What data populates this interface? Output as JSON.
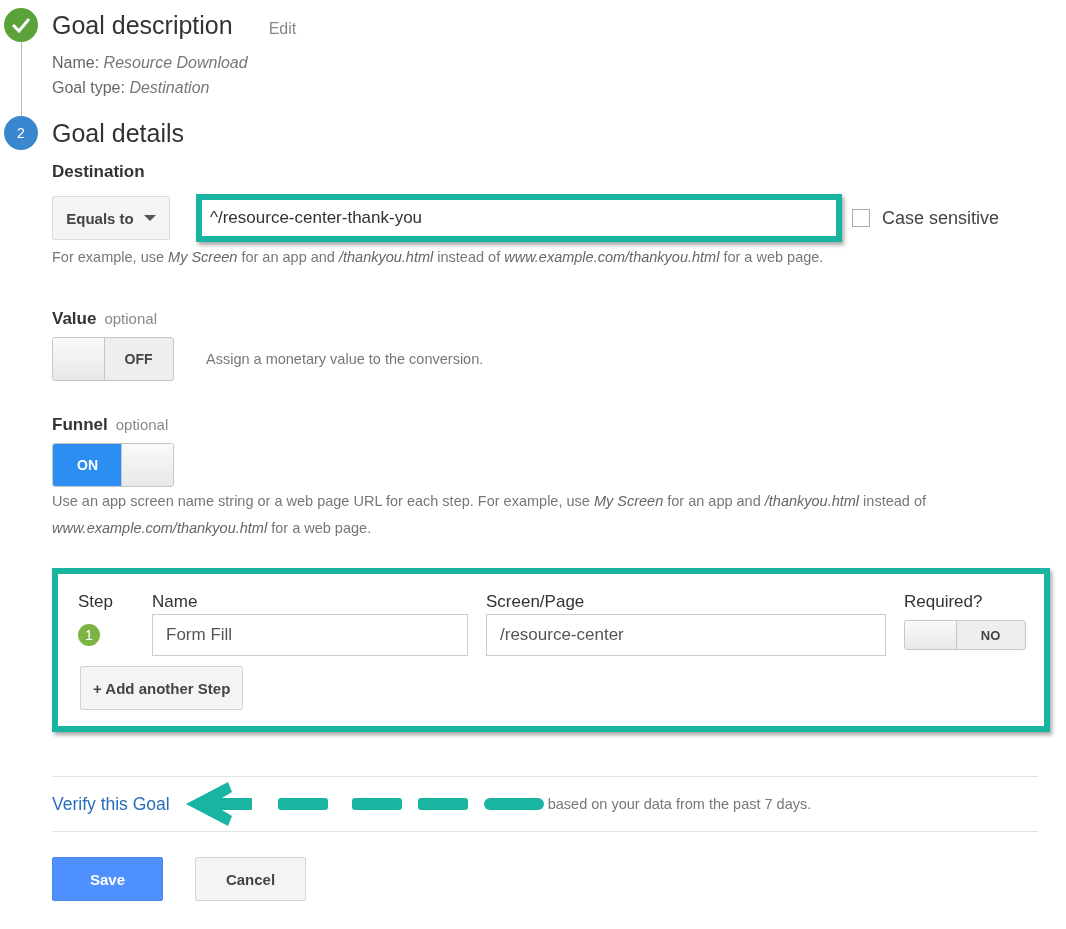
{
  "steps": [
    {
      "done": true,
      "title": "Goal description",
      "action": "Edit",
      "details": [
        {
          "label": "Name:",
          "value": "Resource Download"
        },
        {
          "label": "Goal type:",
          "value": "Destination"
        }
      ]
    },
    {
      "done": false,
      "number": "2",
      "title": "Goal details"
    }
  ],
  "destination": {
    "label": "Destination",
    "match": "Equals to",
    "value": "^/resource-center-thank-you",
    "highlighted": true,
    "case_sensitive": {
      "label": "Case sensitive",
      "checked": false
    },
    "hint": "For example, use *My Screen* for an app and */thankyou.html* instead of *www.example.com/thankyou.html* for a web page."
  },
  "value": {
    "label": "Value",
    "optional": "optional",
    "toggle": {
      "on": false,
      "text": "OFF"
    },
    "description": "Assign a monetary value to the conversion."
  },
  "funnel": {
    "label": "Funnel",
    "optional": "optional",
    "toggle": {
      "on": true,
      "text": "ON"
    },
    "hint": "Use an app screen name string or a web page URL for each step. For example, use *My Screen* for an app and */thankyou.html* instead of *www.example.com/thankyou.html* for a web page.",
    "highlighted": true,
    "columns": [
      "Step",
      "Name",
      "Screen/Page",
      "Required?"
    ],
    "rows": [
      {
        "step": "1",
        "name": "Form Fill",
        "page": "/resource-center",
        "required": {
          "on": false,
          "text": "NO"
        }
      }
    ],
    "add_button": "+ Add another Step"
  },
  "verify": {
    "link": "Verify this Goal",
    "description": "based on your data from the past 7 days."
  },
  "buttons": [
    {
      "label": "Save",
      "kind": "primary"
    },
    {
      "label": "Cancel",
      "kind": "secondary"
    }
  ]
}
